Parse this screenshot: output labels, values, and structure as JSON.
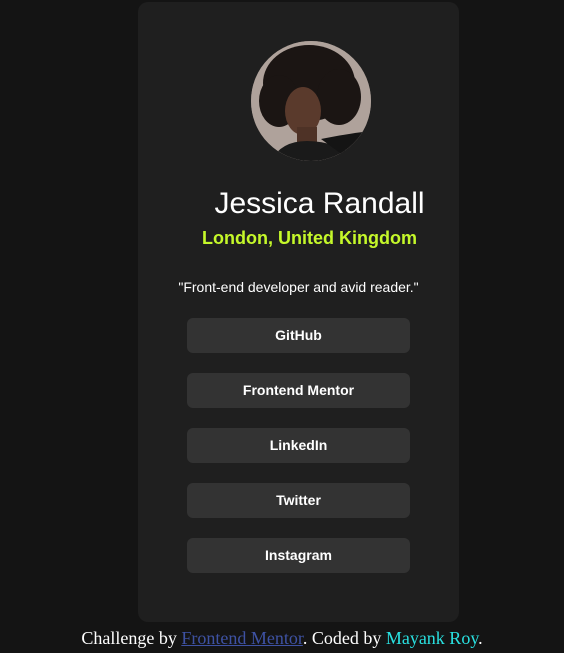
{
  "profile": {
    "name": "Jessica Randall",
    "location": "London, United Kingdom",
    "bio": "\"Front-end developer and avid reader.\"",
    "avatar_icon": "avatar-photo"
  },
  "links": [
    {
      "label": "GitHub"
    },
    {
      "label": "Frontend Mentor"
    },
    {
      "label": "LinkedIn"
    },
    {
      "label": "Twitter"
    },
    {
      "label": "Instagram"
    }
  ],
  "footer": {
    "prefix": "Challenge by ",
    "challenge_link": "Frontend Mentor",
    "middle": ". Coded by ",
    "author_link": "Mayank Roy",
    "suffix": "."
  },
  "colors": {
    "page_bg": "#141414",
    "card_bg": "#1f1f1f",
    "button_bg": "#333333",
    "accent": "#c5f82a",
    "challenge_link": "#3e52a3",
    "author_link": "#29e0e0"
  }
}
